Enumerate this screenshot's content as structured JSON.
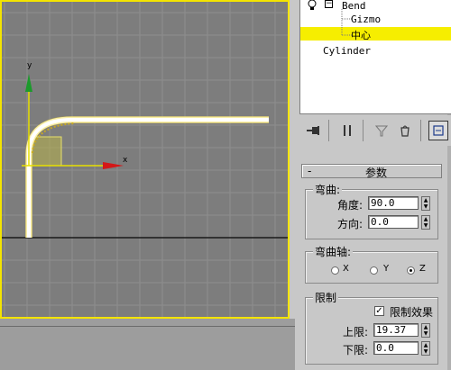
{
  "viewport": {
    "axis_y": "y",
    "axis_x": "x",
    "border_color": "#f4e400"
  },
  "tree": {
    "items": [
      {
        "label": "Bend"
      },
      {
        "label": "Gizmo"
      },
      {
        "label": "中心"
      },
      {
        "label": "Cylinder"
      }
    ],
    "selected_color": "#f6ee00"
  },
  "toolbar": {
    "icons": [
      "pin-icon",
      "pause-bars-icon",
      "funnel-icon",
      "bucket-icon",
      "configure-icon"
    ]
  },
  "params": {
    "rollout_title": "参数",
    "collapse_sign": "-",
    "bend_group": "弯曲:",
    "angle_label": "角度:",
    "angle_value": "90.0",
    "direction_label": "方向:",
    "direction_value": "0.0",
    "axis_group": "弯曲轴:",
    "axis_x": "X",
    "axis_y": "Y",
    "axis_z": "Z",
    "selected_axis": "Z",
    "limit_group": "限制",
    "limit_effect_label": "限制效果",
    "limit_effect_checked": "✓",
    "upper_label": "上限:",
    "upper_value": "19.37",
    "lower_label": "下限:",
    "lower_value": "0.0"
  }
}
